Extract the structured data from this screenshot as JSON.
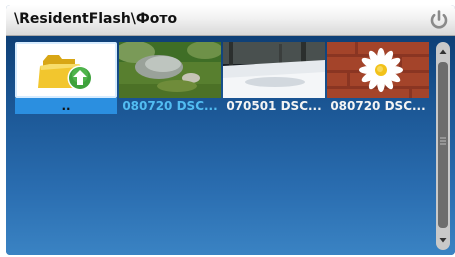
{
  "window": {
    "title": "\\ResidentFlash\\Фото"
  },
  "icons": {
    "power": "power-icon",
    "folder_up": "folder-up-icon"
  },
  "items": [
    {
      "label": "..",
      "kind": "folder-up",
      "selected": true
    },
    {
      "label": "080720 DSC...",
      "kind": "image"
    },
    {
      "label": "070501 DSC...",
      "kind": "image"
    },
    {
      "label": "080720 DSC...",
      "kind": "image"
    }
  ],
  "colors": {
    "background": "#1d4f86",
    "selection": "#2b8fe0",
    "label_highlight": "#52bdf2",
    "label_normal": "#f4f4f4"
  }
}
